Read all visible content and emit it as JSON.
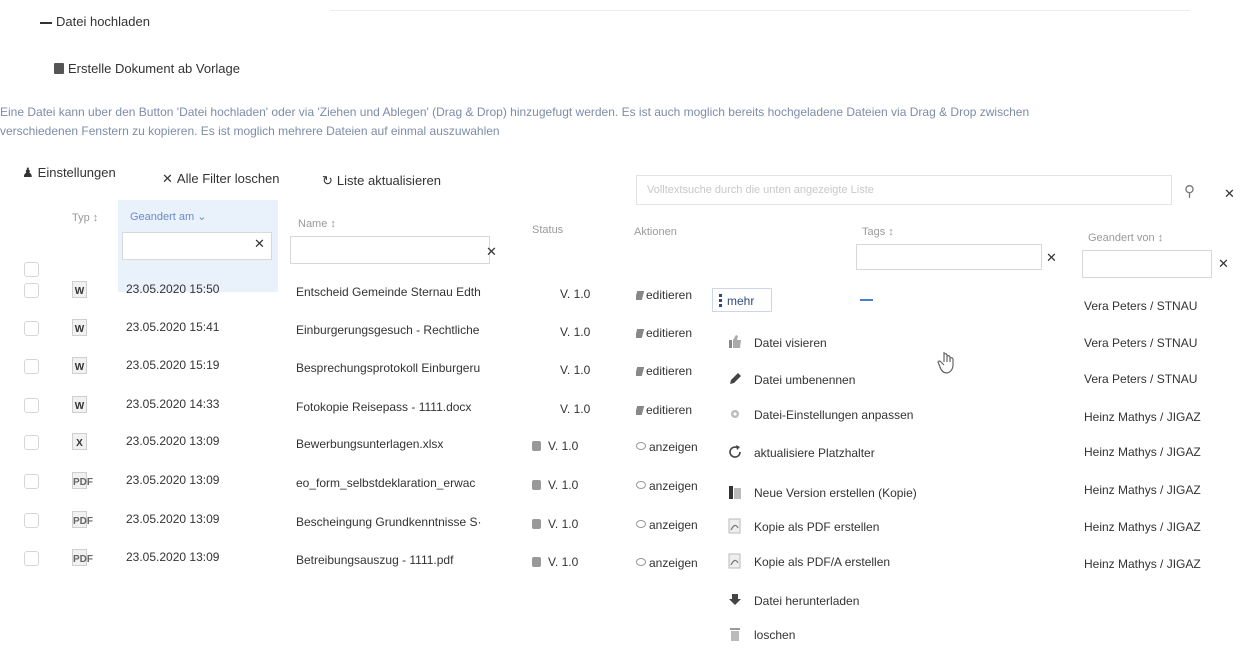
{
  "actions": {
    "upload": "Datei hochladen",
    "template": "Erstelle Dokument ab Vorlage"
  },
  "info": {
    "line1": "Eine Datei kann uber den Button 'Datei hochladen' oder via 'Ziehen und Ablegen' (Drag & Drop) hinzugefugt werden. Es ist auch moglich bereits hochgeladene Dateien via Drag & Drop zwischen",
    "line2": "verschiedenen Fenstern zu kopieren. Es ist moglich mehrere Dateien auf einmal auszuwahlen"
  },
  "toolbar": {
    "settings": "Einstellungen",
    "clear_filters": "Alle Filter loschen",
    "refresh": "Liste aktualisieren",
    "search_placeholder": "Volltextsuche durch die unten angezeigte Liste"
  },
  "columns": {
    "type": "Typ ↕",
    "changed_at": "Geandert am ⌄",
    "name": "Name ↕",
    "status": "Status",
    "actions": "Aktionen",
    "tags": "Tags ↕",
    "changed_by": "Geandert von ↕"
  },
  "rows": [
    {
      "type": "W",
      "date": "23.05.2020 15:50",
      "name": "Entscheid Gemeinde Sternau Edth",
      "version": "V. 1.0",
      "action": "editieren",
      "user": "Vera Peters / STNAU"
    },
    {
      "type": "W",
      "date": "23.05.2020 15:41",
      "name": "Einburgerungsgesuch - Rechtliche",
      "version": "V. 1.0",
      "action": "editieren",
      "user": "Vera Peters / STNAU"
    },
    {
      "type": "W",
      "date": "23.05.2020 15:19",
      "name": "Besprechungsprotokoll Einburgeru",
      "version": "V. 1.0",
      "action": "editieren",
      "user": "Vera Peters / STNAU"
    },
    {
      "type": "W",
      "date": "23.05.2020 14:33",
      "name": "Fotokopie Reisepass - 1111.docx",
      "version": "V. 1.0",
      "action": "editieren",
      "user": "Heinz Mathys / JIGAZ"
    },
    {
      "type": "X",
      "date": "23.05.2020 13:09",
      "name": "Bewerbungsunterlagen.xlsx",
      "version": "V. 1.0",
      "action": "anzeigen",
      "user": "Heinz Mathys / JIGAZ"
    },
    {
      "type": "PDF",
      "date": "23.05.2020 13:09",
      "name": "eo_form_selbstdeklaration_erwac",
      "version": "V. 1.0",
      "action": "anzeigen",
      "user": "Heinz Mathys / JIGAZ"
    },
    {
      "type": "PDF",
      "date": "23.05.2020 13:09",
      "name": "Bescheingung Grundkenntnisse S·",
      "version": "V. 1.0",
      "action": "anzeigen",
      "user": "Heinz Mathys / JIGAZ"
    },
    {
      "type": "PDF",
      "date": "23.05.2020 13:09",
      "name": "Betreibungsauszug - 1111.pdf",
      "version": "V. 1.0",
      "action": "anzeigen",
      "user": "Heinz Mathys / JIGAZ"
    }
  ],
  "more_button": "mehr",
  "menu": [
    {
      "label": "Datei visieren",
      "icon": "thumbs-up-icon"
    },
    {
      "label": "Datei umbenennen",
      "icon": "pencil-icon"
    },
    {
      "label": "Datei-Einstellungen anpassen",
      "icon": "gear-icon"
    },
    {
      "label": "aktualisiere Platzhalter",
      "icon": "refresh-icon"
    },
    {
      "label": "Neue Version erstellen (Kopie)",
      "icon": "copy-icon"
    },
    {
      "label": "Kopie als PDF erstellen",
      "icon": "pdf-icon"
    },
    {
      "label": "Kopie als PDF/A erstellen",
      "icon": "pdf-icon"
    },
    {
      "label": "Datei herunterladen",
      "icon": "download-icon"
    },
    {
      "label": "loschen",
      "icon": "trash-icon"
    }
  ]
}
